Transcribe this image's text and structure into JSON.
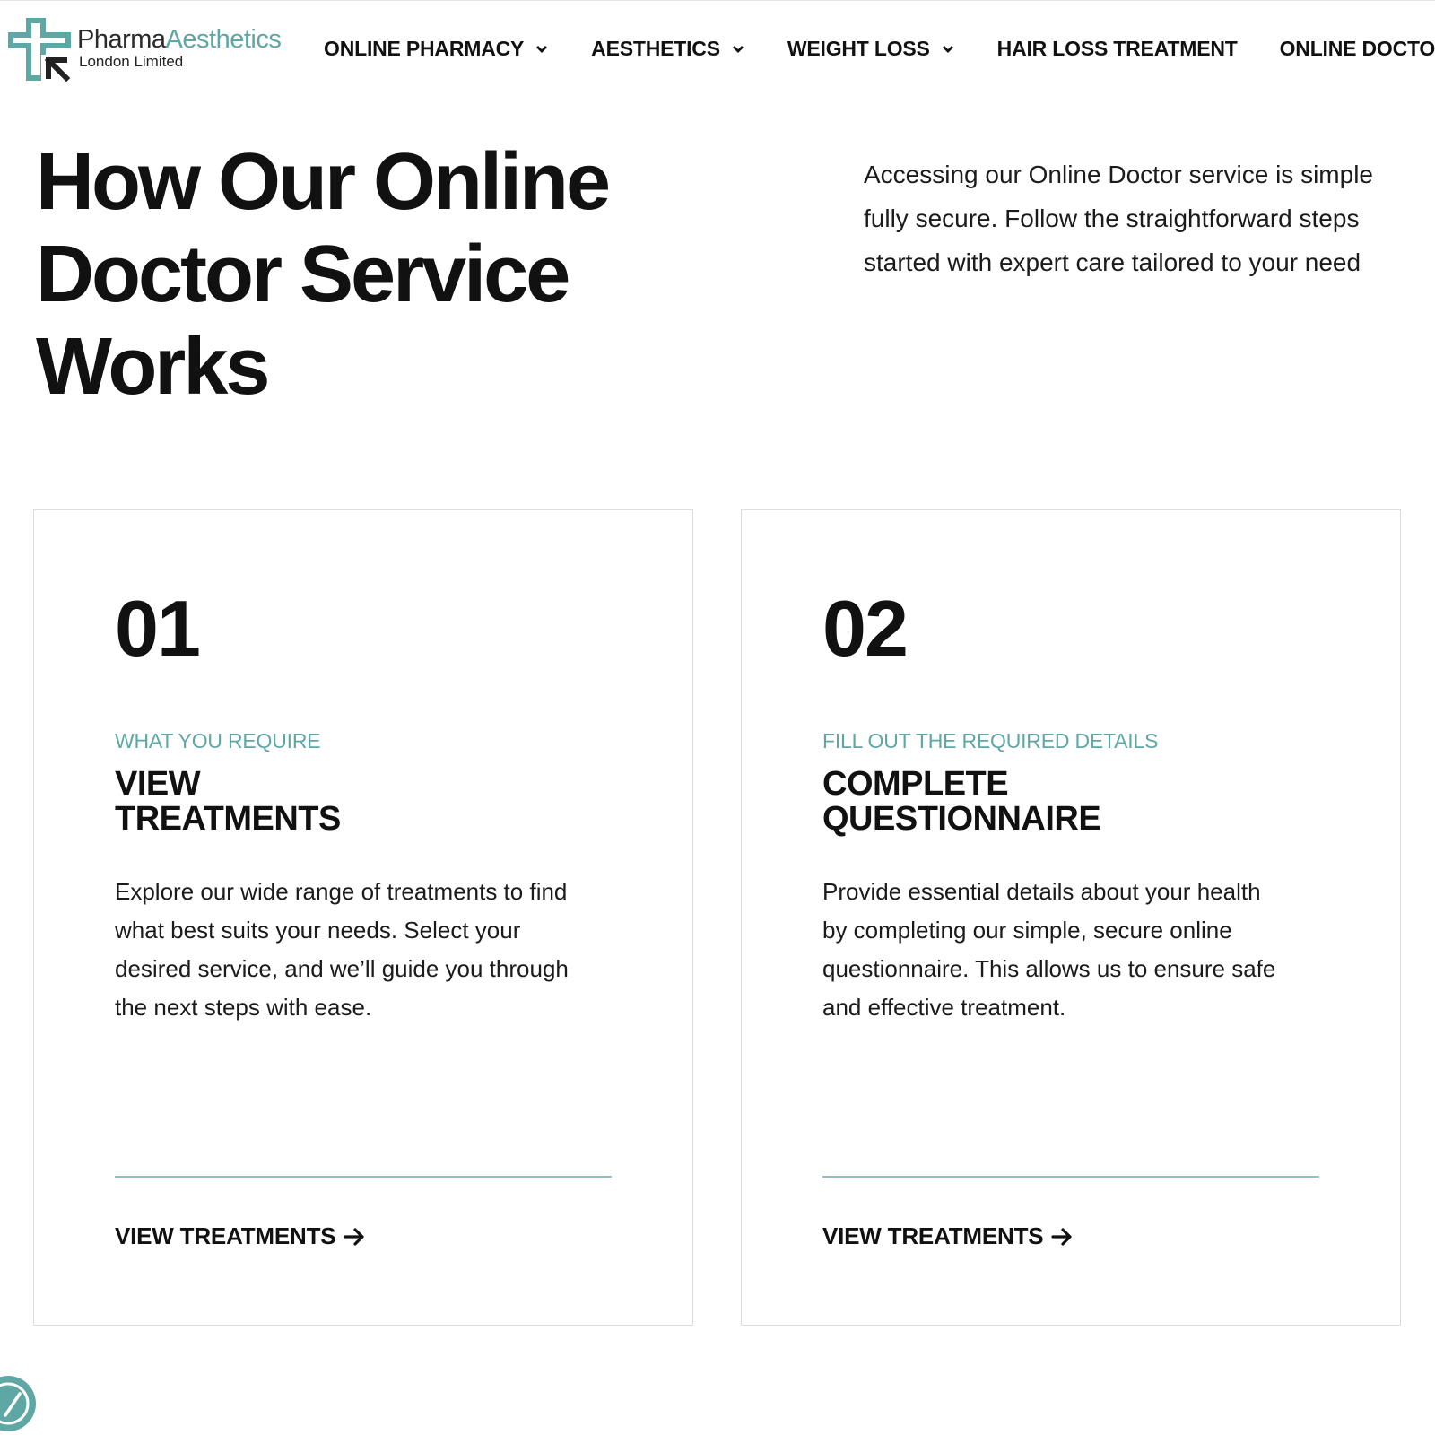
{
  "colors": {
    "accent": "#5fa7a5",
    "text": "#111111",
    "border": "#dddddd"
  },
  "logo": {
    "name_part1": "Pharma",
    "name_part2": "Aesthetics",
    "subtitle": "London Limited",
    "icon": "medical-cross-arrow-icon"
  },
  "nav": {
    "items": [
      {
        "label": "ONLINE PHARMACY",
        "has_dropdown": true
      },
      {
        "label": "AESTHETICS",
        "has_dropdown": true
      },
      {
        "label": "WEIGHT LOSS",
        "has_dropdown": true
      },
      {
        "label": "HAIR LOSS TREATMENT",
        "has_dropdown": false
      },
      {
        "label": "ONLINE DOCTO",
        "has_dropdown": false
      }
    ]
  },
  "hero": {
    "title_lines": [
      "How Our Online",
      "Doctor Service",
      "Works"
    ],
    "intro_lines": [
      "Accessing our Online Doctor service is simple",
      "fully secure. Follow the straightforward steps",
      "started with expert care tailored to your need"
    ]
  },
  "cards": [
    {
      "number": "01",
      "eyebrow": "WHAT YOU REQUIRE",
      "title_lines": [
        "VIEW",
        "TREATMENTS"
      ],
      "desc_lines": [
        "Explore our wide range of treatments to find",
        "what best suits your needs. Select your",
        "desired service, and we’ll guide you through",
        "the next steps with ease."
      ],
      "link_label": "VIEW TREATMENTS",
      "link_icon": "arrow-right-icon"
    },
    {
      "number": "02",
      "eyebrow": "FILL OUT THE REQUIRED DETAILS",
      "title_lines": [
        "COMPLETE",
        "QUESTIONNAIRE"
      ],
      "desc_lines": [
        "Provide essential details about your health",
        "by completing our simple, secure online",
        "questionnaire. This allows us to ensure safe",
        "and effective treatment."
      ],
      "link_label": "VIEW TREATMENTS",
      "link_icon": "arrow-right-icon"
    }
  ],
  "floating_badge": {
    "icon": "checkmark-badge-icon"
  }
}
